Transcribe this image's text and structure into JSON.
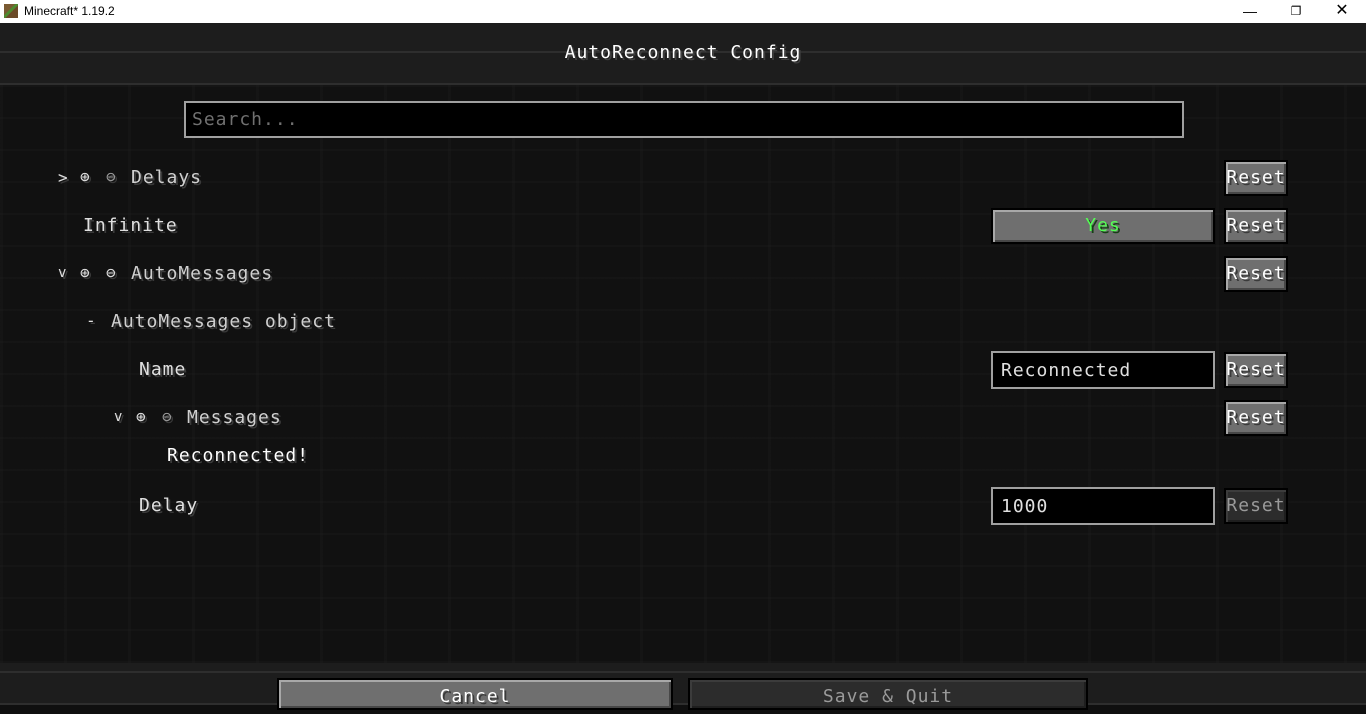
{
  "window": {
    "title": "Minecraft* 1.19.2",
    "minimize": "—",
    "maximize": "❐",
    "close": "✕"
  },
  "screen": {
    "title": "AutoReconnect Config"
  },
  "search": {
    "placeholder": "Search...",
    "value": ""
  },
  "entries": {
    "delays": {
      "label": "Delays",
      "expander": ">",
      "add_icon": "⊕",
      "remove_icon": "⊖",
      "reset": "Reset"
    },
    "infinite": {
      "label": "Infinite",
      "value": "Yes",
      "reset": "Reset"
    },
    "automessages": {
      "label": "AutoMessages",
      "expander": "v",
      "add_icon": "⊕",
      "remove_icon": "⊖",
      "reset": "Reset"
    },
    "automessages_object": {
      "remove_icon": "-",
      "label": "AutoMessages object"
    },
    "name": {
      "label": "Name",
      "value": "Reconnected",
      "reset": "Reset"
    },
    "messages": {
      "label": "Messages",
      "expander": "v",
      "add_icon": "⊕",
      "remove_icon": "⊖",
      "reset": "Reset",
      "items": [
        "Reconnected!"
      ]
    },
    "delay": {
      "label": "Delay",
      "value": "1000",
      "reset": "Reset"
    }
  },
  "footer": {
    "cancel": "Cancel",
    "save_quit": "Save & Quit"
  },
  "colors": {
    "yes_green": "#55ff55",
    "text": "#e0e0e0",
    "background": "#111111"
  }
}
